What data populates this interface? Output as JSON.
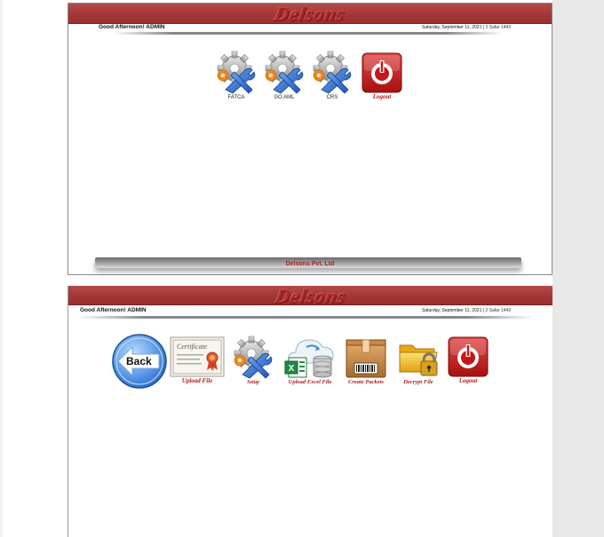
{
  "screen1": {
    "logo": "Delsons",
    "greeting": "Good Afternoon! ADMIN",
    "date": "Saturday, September 11, 2021",
    "hijri": "2 Safar 1443",
    "menu": [
      {
        "label": "FATCA",
        "icon": "gear-tools-icon"
      },
      {
        "label": "GO AML",
        "icon": "gear-tools-icon"
      },
      {
        "label": "CRS",
        "icon": "gear-tools-icon"
      },
      {
        "label": "Logout",
        "icon": "power-icon"
      }
    ],
    "footer": "Delsons Pvt. Ltd"
  },
  "screen2": {
    "logo": "Delsons",
    "greeting": "Good Afternoon! ADMIN",
    "date": "Saturday, September 11, 2021",
    "hijri": "2 Safar 1443",
    "back_label": "Back",
    "menu": [
      {
        "label": "Upload File",
        "icon": "certificate-icon"
      },
      {
        "label": "Setup",
        "icon": "gear-tools-icon"
      },
      {
        "label": "Upload Excel File",
        "icon": "excel-database-icon"
      },
      {
        "label": "Create Packets",
        "icon": "package-box-icon"
      },
      {
        "label": "Decrypt File",
        "icon": "folder-lock-icon"
      },
      {
        "label": "Logout",
        "icon": "power-icon"
      }
    ]
  },
  "colors": {
    "banner": "#a33535",
    "logo": "#a82828",
    "label_red": "#b01818",
    "back_blue": "#3a7fd8"
  }
}
